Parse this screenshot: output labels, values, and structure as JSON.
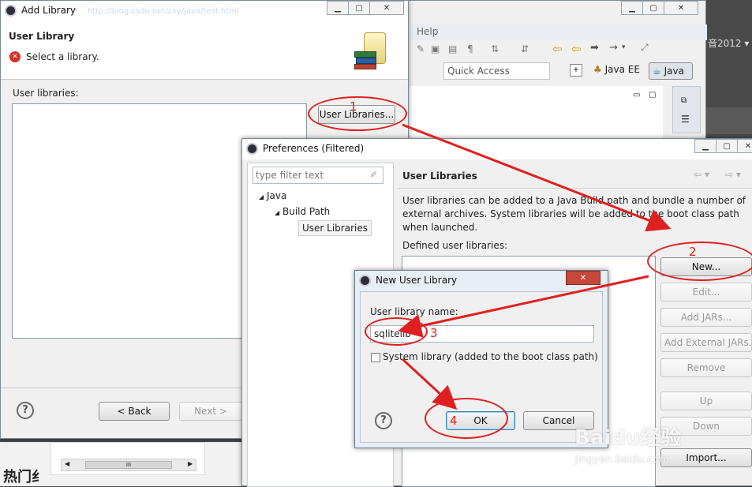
{
  "eclipse": {
    "help_menu": "Help",
    "right_text": "音2012 ▾",
    "quick_access": "Quick Access",
    "perspective_javaee": "Java EE",
    "perspective_java": "Java",
    "bottom_left_text": "热门纟"
  },
  "add_library": {
    "title": "Add Library",
    "title_url_blur": "http://blog.csdn.net/zxy/java/test.html",
    "header": "User Library",
    "message": "Select a library.",
    "user_libraries_label": "User libraries:",
    "user_libraries_button": "User Libraries...",
    "back_button": "< Back",
    "next_button": "Next >",
    "scroll_thumb": "III"
  },
  "preferences": {
    "title": "Preferences (Filtered)",
    "filter_placeholder": "type filter text",
    "tree": {
      "java": "Java",
      "build_path": "Build Path",
      "user_libraries": "User Libraries"
    },
    "page_title": "User Libraries",
    "description": "User libraries can be added to a Java Build path and bundle a number of external archives. System libraries will be added to the boot class path when launched.",
    "defined_label": "Defined user libraries:",
    "buttons": {
      "new": "New...",
      "edit": "Edit...",
      "add_jars": "Add JARs...",
      "add_external": "Add External JARs...",
      "remove": "Remove",
      "up": "Up",
      "down": "Down",
      "import": "Import..."
    }
  },
  "new_user_library": {
    "title": "New User Library",
    "name_label": "User library name:",
    "name_value": "sqlitelib",
    "system_label": "System library (added to the boot class path)",
    "ok": "OK",
    "cancel": "Cancel"
  },
  "annotations": {
    "n1": "1",
    "n2": "2",
    "n3": "3",
    "n4": "4"
  },
  "watermark": {
    "main": "Baidu经验",
    "sub": "jingyan.baidu.com"
  },
  "colors": {
    "annotation": "#e02020",
    "selection": "#3c7fb1",
    "eclipse_bg": "#f0f0f0"
  }
}
